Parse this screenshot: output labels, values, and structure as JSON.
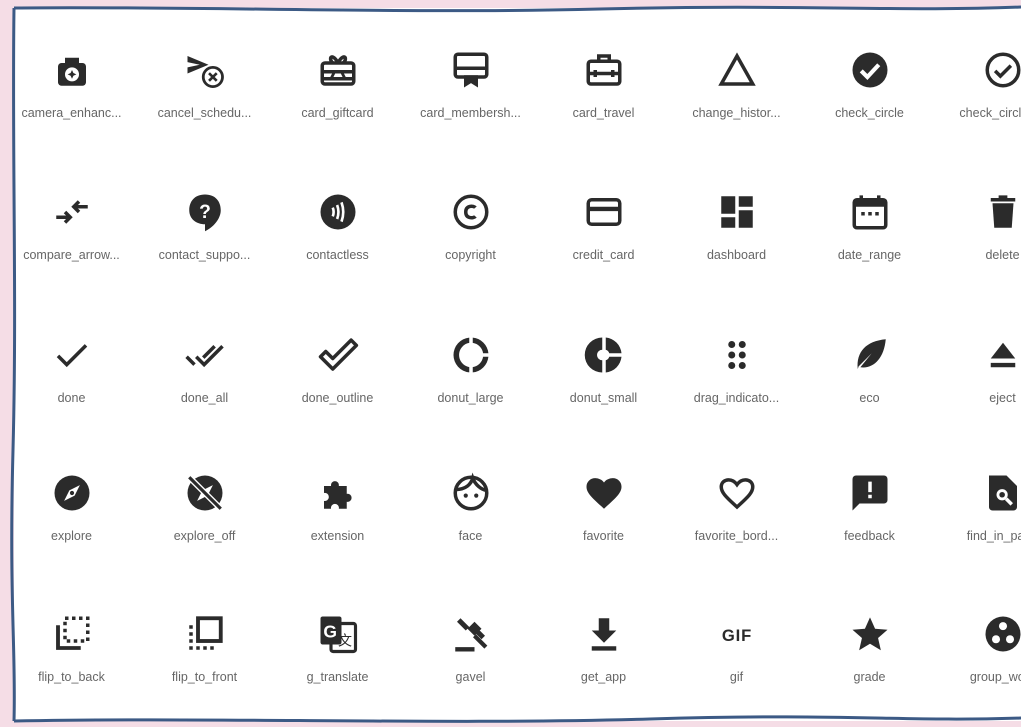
{
  "icons": [
    {
      "label": "camera_enhanc...",
      "icon": "camera-enhance-icon"
    },
    {
      "label": "cancel_schedu...",
      "icon": "cancel-schedule-send-icon"
    },
    {
      "label": "card_giftcard",
      "icon": "card-giftcard-icon"
    },
    {
      "label": "card_membersh...",
      "icon": "card-membership-icon"
    },
    {
      "label": "card_travel",
      "icon": "card-travel-icon"
    },
    {
      "label": "change_histor...",
      "icon": "change-history-icon"
    },
    {
      "label": "check_circle",
      "icon": "check-circle-icon"
    },
    {
      "label": "check_circle_...",
      "icon": "check-circle-outline-icon"
    },
    {
      "label": "compare_arrow...",
      "icon": "compare-arrows-icon"
    },
    {
      "label": "contact_suppo...",
      "icon": "contact-support-icon"
    },
    {
      "label": "contactless",
      "icon": "contactless-icon"
    },
    {
      "label": "copyright",
      "icon": "copyright-icon"
    },
    {
      "label": "credit_card",
      "icon": "credit-card-icon"
    },
    {
      "label": "dashboard",
      "icon": "dashboard-icon"
    },
    {
      "label": "date_range",
      "icon": "date-range-icon"
    },
    {
      "label": "delete",
      "icon": "delete-icon"
    },
    {
      "label": "done",
      "icon": "done-icon"
    },
    {
      "label": "done_all",
      "icon": "done-all-icon"
    },
    {
      "label": "done_outline",
      "icon": "done-outline-icon"
    },
    {
      "label": "donut_large",
      "icon": "donut-large-icon"
    },
    {
      "label": "donut_small",
      "icon": "donut-small-icon"
    },
    {
      "label": "drag_indicato...",
      "icon": "drag-indicator-icon"
    },
    {
      "label": "eco",
      "icon": "eco-icon"
    },
    {
      "label": "eject",
      "icon": "eject-icon"
    },
    {
      "label": "explore",
      "icon": "explore-icon"
    },
    {
      "label": "explore_off",
      "icon": "explore-off-icon"
    },
    {
      "label": "extension",
      "icon": "extension-icon"
    },
    {
      "label": "face",
      "icon": "face-icon"
    },
    {
      "label": "favorite",
      "icon": "favorite-icon"
    },
    {
      "label": "favorite_bord...",
      "icon": "favorite-border-icon"
    },
    {
      "label": "feedback",
      "icon": "feedback-icon"
    },
    {
      "label": "find_in_page",
      "icon": "find-in-page-icon"
    },
    {
      "label": "flip_to_back",
      "icon": "flip-to-back-icon"
    },
    {
      "label": "flip_to_front",
      "icon": "flip-to-front-icon"
    },
    {
      "label": "g_translate",
      "icon": "g-translate-icon"
    },
    {
      "label": "gavel",
      "icon": "gavel-icon"
    },
    {
      "label": "get_app",
      "icon": "get-app-icon"
    },
    {
      "label": "gif",
      "icon": "gif-icon"
    },
    {
      "label": "grade",
      "icon": "grade-icon"
    },
    {
      "label": "group_work",
      "icon": "group-work-icon"
    }
  ],
  "colors": {
    "icon": "#2b2b2b",
    "label": "#666666",
    "frame": "#3c5a85",
    "backdrop": "#f5dde6"
  }
}
